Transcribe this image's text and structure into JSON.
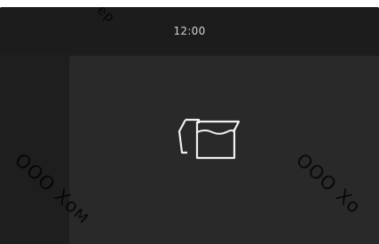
{
  "status_bar": {
    "time": "12:00"
  },
  "main": {
    "icon": "milk-jug-icon"
  },
  "watermarks": {
    "top": "ер",
    "left": "ООО Хом",
    "right": "ООО Хо"
  },
  "colors": {
    "screen_background": "#1e1e1e",
    "panel_background": "#292929",
    "icon_stroke": "#f0f0f0"
  }
}
